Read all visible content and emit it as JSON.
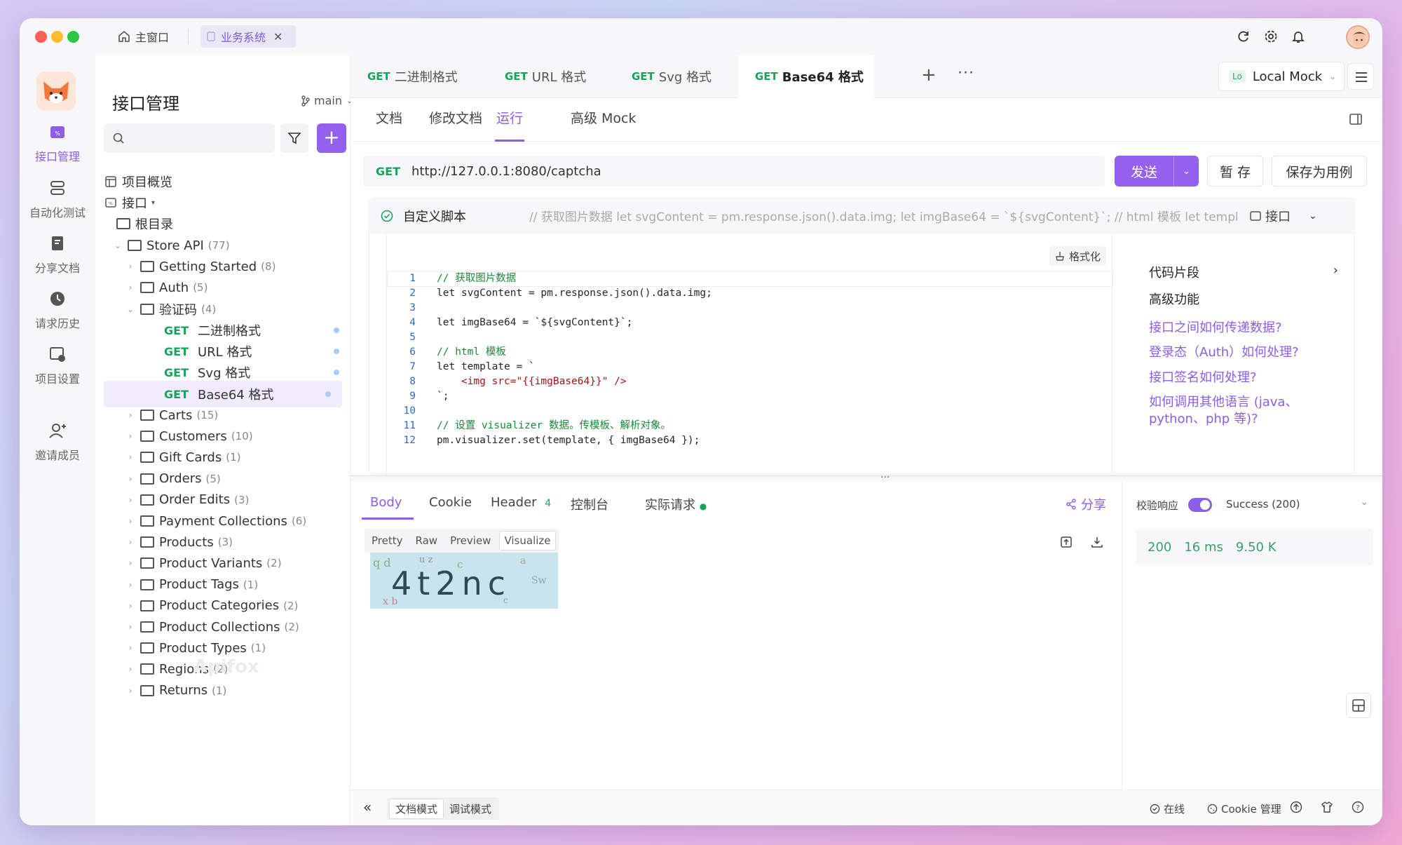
{
  "window": {
    "home_tab": "主窗口",
    "biz_tab": "业务系统"
  },
  "rail": {
    "items": [
      {
        "label": "接口管理"
      },
      {
        "label": "自动化测试"
      },
      {
        "label": "分享文档"
      },
      {
        "label": "请求历史"
      },
      {
        "label": "项目设置"
      },
      {
        "label": "邀请成员"
      }
    ]
  },
  "tree": {
    "title": "接口管理",
    "branch": "main",
    "overview": "项目概览",
    "api_root": "接口",
    "root_dir": "根目录",
    "store": {
      "name": "Store API",
      "count": "(77)"
    },
    "groups_top": [
      {
        "name": "Getting Started",
        "count": "(8)"
      },
      {
        "name": "Auth",
        "count": "(5)"
      },
      {
        "name": "验证码",
        "count": "(4)"
      }
    ],
    "endpoints": [
      {
        "method": "GET",
        "name": "二进制格式"
      },
      {
        "method": "GET",
        "name": "URL 格式"
      },
      {
        "method": "GET",
        "name": "Svg 格式"
      },
      {
        "method": "GET",
        "name": "Base64 格式"
      }
    ],
    "groups": [
      {
        "name": "Carts",
        "count": "(15)"
      },
      {
        "name": "Customers",
        "count": "(10)"
      },
      {
        "name": "Gift Cards",
        "count": "(1)"
      },
      {
        "name": "Orders",
        "count": "(5)"
      },
      {
        "name": "Order Edits",
        "count": "(3)"
      },
      {
        "name": "Payment Collections",
        "count": "(6)"
      },
      {
        "name": "Products",
        "count": "(3)"
      },
      {
        "name": "Product Variants",
        "count": "(2)"
      },
      {
        "name": "Product Tags",
        "count": "(1)"
      },
      {
        "name": "Product Categories",
        "count": "(2)"
      },
      {
        "name": "Product Collections",
        "count": "(2)"
      },
      {
        "name": "Product Types",
        "count": "(1)"
      },
      {
        "name": "Regions",
        "count": "(2)"
      },
      {
        "name": "Returns",
        "count": "(1)"
      }
    ],
    "watermark": "Apifox"
  },
  "editor_tabs": [
    {
      "method": "GET",
      "name": "二进制格式"
    },
    {
      "method": "GET",
      "name": "URL 格式"
    },
    {
      "method": "GET",
      "name": "Svg 格式"
    },
    {
      "method": "GET",
      "name": "Base64 格式"
    }
  ],
  "env": {
    "badge": "Lo",
    "name": "Local Mock"
  },
  "sub_tabs": [
    "文档",
    "修改文档",
    "运行",
    "高级 Mock"
  ],
  "request": {
    "method": "GET",
    "url": "http://127.0.0.1:8080/captcha",
    "send": "发送",
    "save_temp": "暂 存",
    "save_case": "保存为用例"
  },
  "script": {
    "title": "自定义脚本",
    "preview": "// 获取图片数据 let svgContent = pm.response.json().data.img; let imgBase64 = `${svgContent}`; // html 模板 let template = ...",
    "scope": "接口",
    "format": "格式化",
    "lines": [
      {
        "n": "1",
        "t": "// 获取图片数据",
        "c": "cm"
      },
      {
        "n": "2",
        "t": "let svgContent = pm.response.json().data.img;",
        "c": ""
      },
      {
        "n": "3",
        "t": "",
        "c": ""
      },
      {
        "n": "4",
        "t": "let imgBase64 = `${svgContent}`;",
        "c": ""
      },
      {
        "n": "5",
        "t": "",
        "c": ""
      },
      {
        "n": "6",
        "t": "// html 模板",
        "c": "cm"
      },
      {
        "n": "7",
        "t": "let template = `",
        "c": ""
      },
      {
        "n": "8",
        "t": "    <img src=\"{{imgBase64}}\" />",
        "c": "str"
      },
      {
        "n": "9",
        "t": "`;",
        "c": ""
      },
      {
        "n": "10",
        "t": "",
        "c": ""
      },
      {
        "n": "11",
        "t": "// 设置 visualizer 数据。传模板、解析对象。",
        "c": "cm"
      },
      {
        "n": "12",
        "t": "pm.visualizer.set(template, { imgBase64 });",
        "c": ""
      }
    ]
  },
  "snippets": {
    "code_snip": "代码片段",
    "advanced": "高级功能",
    "links": [
      "接口之间如何传递数据?",
      "登录态（Auth）如何处理?",
      "接口签名如何处理?",
      "如何调用其他语言 (java、",
      "python、php 等)?"
    ]
  },
  "response": {
    "tabs": [
      "Body",
      "Cookie",
      "Header",
      "控制台",
      "实际请求"
    ],
    "header_count": "4",
    "share": "分享",
    "views": [
      "Pretty",
      "Raw",
      "Preview",
      "Visualize"
    ],
    "captcha_text": "4t2nc"
  },
  "validation": {
    "label": "校验响应",
    "status": "Success (200)",
    "code": "200",
    "time": "16 ms",
    "size": "9.50 K"
  },
  "bottom": {
    "doc_mode": "文档模式",
    "debug_mode": "调试模式",
    "online": "在线",
    "cookie": "Cookie 管理"
  },
  "colors": {
    "accent": "#9361ec",
    "get": "#18a35a"
  }
}
